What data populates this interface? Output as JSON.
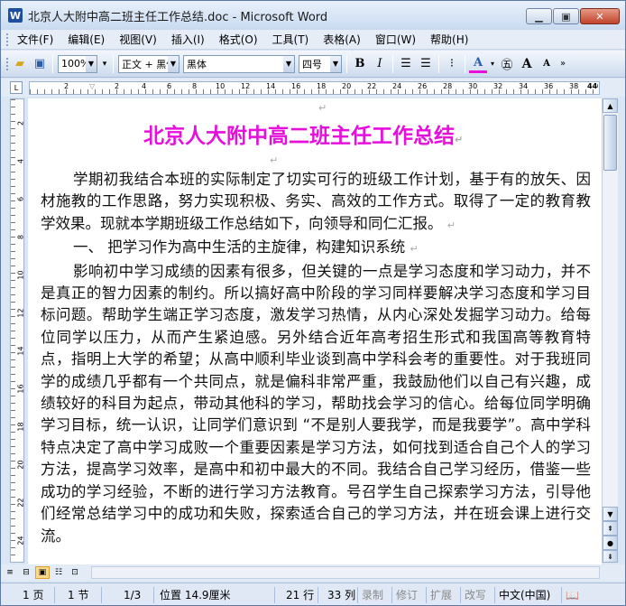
{
  "window": {
    "title": "北京人大附中高二班主任工作总结.doc - Microsoft Word",
    "app_icon": "W"
  },
  "menu": [
    "文件(F)",
    "编辑(E)",
    "视图(V)",
    "插入(I)",
    "格式(O)",
    "工具(T)",
    "表格(A)",
    "窗口(W)",
    "帮助(H)"
  ],
  "toolbar": {
    "zoom": "100%",
    "style": "正文 + 黑体",
    "font": "黑体",
    "size": "四号",
    "bold": "B",
    "italic": "I",
    "font_color": "A",
    "grow": "A",
    "shrink": "A",
    "overflow": "»"
  },
  "ruler": {
    "numbers": [
      "2",
      "2",
      "4",
      "6",
      "8",
      "10",
      "12",
      "14",
      "16",
      "18",
      "20",
      "22",
      "24",
      "26",
      "28",
      "30",
      "32",
      "34",
      "36",
      "38",
      "40",
      "44"
    ],
    "vnumbers": [
      "2",
      "4",
      "6",
      "8",
      "10",
      "12",
      "14",
      "16",
      "18",
      "20",
      "22",
      "24"
    ]
  },
  "document": {
    "title": "北京人大附中高二班主任工作总结",
    "paragraphs": [
      "学期初我结合本班的实际制定了切实可行的班级工作计划，基于有的放矢、因材施教的工作思路，努力实现积极、务实、高效的工作方式。取得了一定的教育教学效果。现就本学期班级工作总结如下，向领导和同仁汇报。",
      "一、  把学习作为高中生活的主旋律，构建知识系统",
      "影响初中学习成绩的因素有很多，但关键的一点是学习态度和学习动力，并不是真正的智力因素的制约。所以搞好高中阶段的学习同样要解决学习态度和学习目标问题。帮助学生端正学习态度，激发学习热情，从内心深处发掘学习动力。给每位同学以压力，从而产生紧迫感。另外结合近年高考招生形式和我国高等教育特点，指明上大学的希望；从高中顺利毕业谈到高中学科会考的重要性。对于我班同学的成绩几乎都有一个共同点，就是偏科非常严重，我鼓励他们以自己有兴趣，成绩较好的科目为起点，带动其他科的学习，帮助找会学习的信心。给每位同学明确学习目标，统一认识，让同学们意识到 “不是别人要我学，而是我要学”。高中学科特点决定了高中学习成败一个重要因素是学习方法，如何找到适合自己个人的学习方法，提高学习效率，是高中和初中最大的不同。我结合自己学习经历，借鉴一些成功的学习经验，不断的进行学习方法教育。号召学生自己探索学习方法，引导他们经常总结学习中的成功和失败，探索适合自己的学习方法，并在班会课上进行交流。"
    ]
  },
  "status": {
    "page": "1 页",
    "section": "1 节",
    "pages": "1/3",
    "position": "位置 14.9厘米",
    "line": "21 行",
    "col": "33 列",
    "rec": "录制",
    "trk": "修订",
    "ext": "扩展",
    "ovr": "改写",
    "lang": "中文(中国)"
  }
}
